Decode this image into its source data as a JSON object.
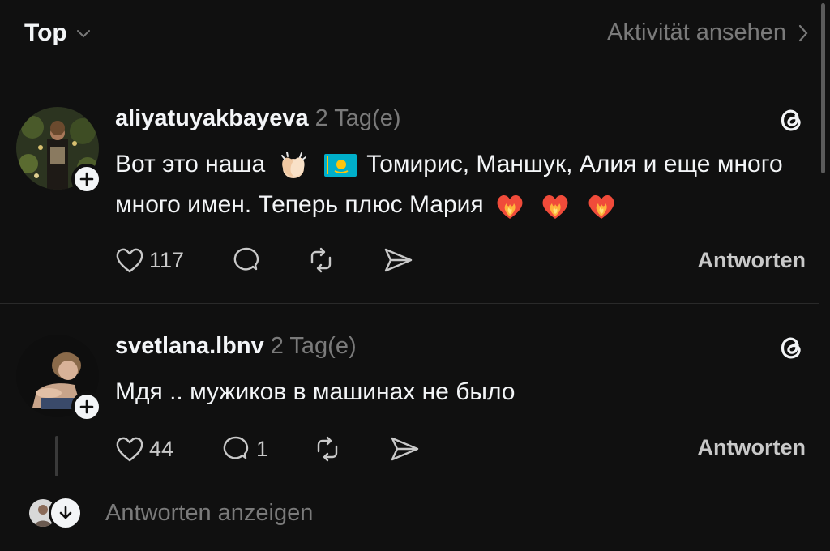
{
  "header": {
    "sort_label": "Top",
    "activity_label": "Aktivität ansehen"
  },
  "posts": [
    {
      "username": "aliyatuyakbayeva",
      "time": "2 Tag(e)",
      "text_part1": "Вот это наша",
      "text_part2": "Томирис, Маншук, Алия и еще много много имен. Теперь плюс Мария",
      "emojis": [
        "clapping-hands",
        "kazakhstan-flag",
        "heart-on-fire",
        "heart-on-fire",
        "heart-on-fire"
      ],
      "likes": "117",
      "comments": "",
      "reply_label": "Antworten"
    },
    {
      "username": "svetlana.lbnv",
      "time": "2 Tag(e)",
      "text": "Мдя .. мужиков в машинах не было",
      "likes": "44",
      "comments": "1",
      "reply_label": "Antworten"
    }
  ],
  "show_replies_label": "Antworten anzeigen",
  "colors": {
    "background": "#101010",
    "primary_text": "#f3f5f7",
    "secondary_text": "#7a7a7a",
    "divider": "#2a2a2a"
  }
}
